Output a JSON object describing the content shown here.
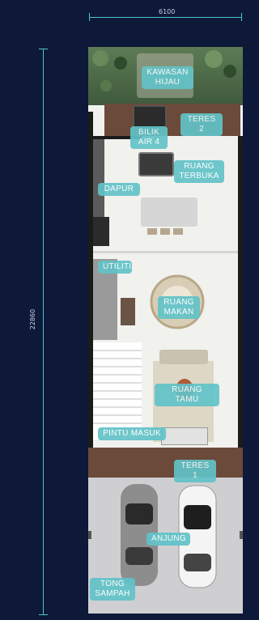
{
  "dimensions": {
    "width": "6100",
    "length": "22860"
  },
  "rooms": {
    "kawasan_hijau": "KAWASAN\nHIJAU",
    "teres_2": "TERES 2",
    "bilik_air_4": "BILIK\nAIR 4",
    "ruang_terbuka": "RUANG\nTERBUKA",
    "dapur": "DAPUR",
    "utiliti": "UTILITI",
    "ruang_makan": "RUANG\nMAKAN",
    "ruang_tamu": "RUANG TAMU",
    "pintu_masuk": "PINTU MASUK",
    "teres_1": "TERES 1",
    "anjung": "ANJUNG",
    "tong_sampah": "TONG\nSAMPAH"
  },
  "colors": {
    "background": "#0e1838",
    "dimension_line": "#4fc4cf",
    "label": "#62c3c8",
    "wall": "#1b1b1b",
    "floor": "#f1f1ee",
    "deck": "#6b4a3a",
    "garden": "#4f6b4a",
    "porch": "#cfcfd2"
  },
  "icons": [
    "car-icon",
    "dining-table-icon",
    "sofa-icon",
    "kitchen-counter-icon",
    "bathtub-icon",
    "plant-icon"
  ]
}
